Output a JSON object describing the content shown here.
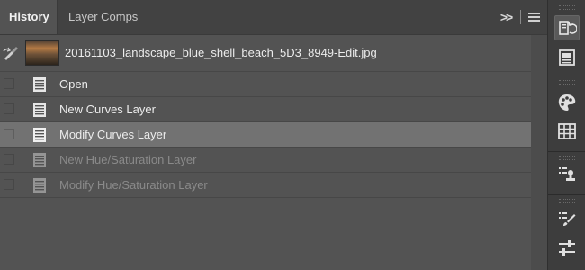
{
  "tabs": [
    {
      "label": "History",
      "active": true
    },
    {
      "label": "Layer Comps",
      "active": false
    }
  ],
  "tab_tools": {
    "collapse_glyph": ">>"
  },
  "snapshot": {
    "label": "20161103_landscape_blue_shell_beach_5D3_8949-Edit.jpg"
  },
  "history": [
    {
      "label": "Open",
      "state": "normal"
    },
    {
      "label": "New Curves Layer",
      "state": "normal"
    },
    {
      "label": "Modify Curves Layer",
      "state": "selected"
    },
    {
      "label": "New Hue/Saturation Layer",
      "state": "undone"
    },
    {
      "label": "Modify Hue/Saturation Layer",
      "state": "undone"
    }
  ],
  "dock": {
    "icons": [
      "history-icon",
      "properties-icon",
      "swatches-icon",
      "grid-icon",
      "clone-source-icon",
      "brush-settings-icon",
      "adjustments-icon"
    ],
    "active": "history-icon"
  },
  "colors": {
    "panel_bg": "#535353",
    "tabbar_bg": "#424242",
    "selected_row": "#727272",
    "dock_bg": "#3d3d3d",
    "text": "#ececec",
    "text_dim": "#8a8a8a"
  }
}
